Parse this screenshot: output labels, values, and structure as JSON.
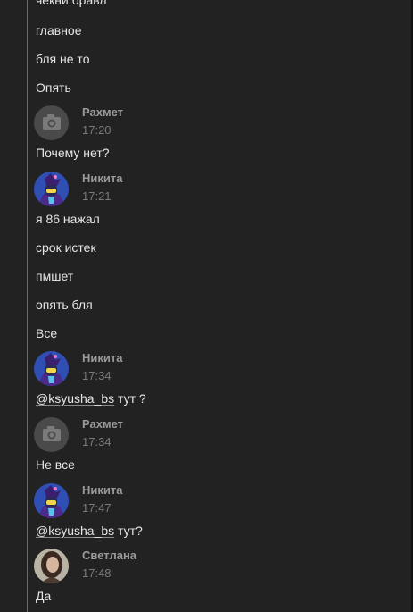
{
  "messages_top": {
    "cut_text": "чекни бравл",
    "m1": "главное",
    "m2": "бля не то",
    "m3": "Опять"
  },
  "block_rahmet_1": {
    "author": "Рахмет",
    "time": "17:20",
    "m1": "Почему нет?"
  },
  "block_nikita_1": {
    "author": "Никита",
    "time": "17:21",
    "m1": "я 86 нажал",
    "m2": "срок истек",
    "m3": "пмшет",
    "m4": "опять бля",
    "m5": "Все"
  },
  "block_nikita_2": {
    "author": "Никита",
    "time": "17:34",
    "mention": "@ksyusha_bs",
    "m1_rest": " тут ?"
  },
  "block_rahmet_2": {
    "author": "Рахмет",
    "time": "17:34",
    "m1": "Не все"
  },
  "block_nikita_3": {
    "author": "Никита",
    "time": "17:47",
    "mention": "@ksyusha_bs",
    "m1_rest": " тут?"
  },
  "block_svetlana": {
    "author": "Светлана",
    "time": "17:48",
    "m1": "Да"
  }
}
